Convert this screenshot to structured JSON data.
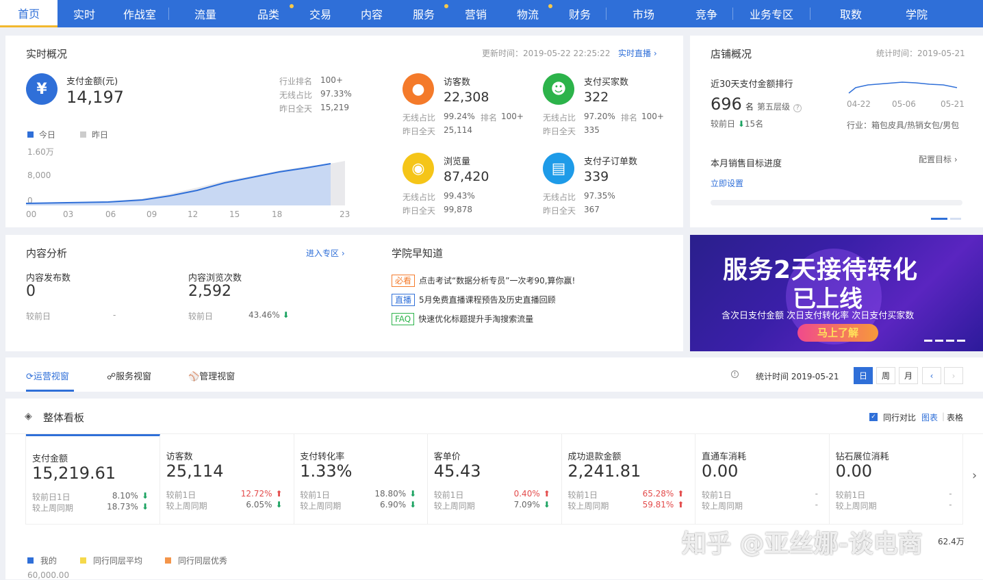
{
  "nav": {
    "items": [
      {
        "label": "首页",
        "x": "active"
      },
      {
        "label": "实时"
      },
      {
        "label": "作战室"
      },
      {
        "label": "流量"
      },
      {
        "label": "品类",
        "dot": true
      },
      {
        "label": "交易"
      },
      {
        "label": "内容"
      },
      {
        "label": "服务",
        "dot": true
      },
      {
        "label": "营销"
      },
      {
        "label": "物流",
        "dot": true
      },
      {
        "label": "财务"
      },
      {
        "label": "市场"
      },
      {
        "label": "竞争"
      },
      {
        "label": "业务专区"
      },
      {
        "label": "取数"
      },
      {
        "label": "学院"
      }
    ]
  },
  "realtime": {
    "title": "实时概况",
    "update_label": "更新时间：2019-05-22 22:25:22",
    "live_link": "实时直播",
    "pay": {
      "label": "支付金额(元)",
      "value": "14,197",
      "rank_label": "行业排名",
      "rank": "100+",
      "wireless_label": "无线占比",
      "wireless": "97.33%",
      "yday_label": "昨日全天",
      "yday": "15,219"
    },
    "legend_today": "今日",
    "legend_yesterday": "昨日",
    "y_ticks": [
      "1.60万",
      "8,000",
      "0"
    ],
    "x_ticks": [
      "00",
      "03",
      "06",
      "09",
      "12",
      "15",
      "18",
      "23"
    ],
    "metrics": [
      {
        "label": "访客数",
        "value": "22,308",
        "wireless_label": "无线占比",
        "wireless": "99.24%",
        "rank_label": "排名",
        "rank": "100+",
        "yday_label": "昨日全天",
        "yday": "25,114",
        "color": "#f47a2a",
        "icon": "footprint-icon"
      },
      {
        "label": "支付买家数",
        "value": "322",
        "wireless_label": "无线占比",
        "wireless": "97.20%",
        "rank_label": "排名",
        "rank": "100+",
        "yday_label": "昨日全天",
        "yday": "335",
        "color": "#2cb34a",
        "icon": "users-icon"
      },
      {
        "label": "浏览量",
        "value": "87,420",
        "wireless_label": "无线占比",
        "wireless": "99.43%",
        "rank_label": "",
        "rank": "",
        "yday_label": "昨日全天",
        "yday": "99,878",
        "color": "#f5c518",
        "icon": "eye-icon"
      },
      {
        "label": "支付子订单数",
        "value": "339",
        "wireless_label": "无线占比",
        "wireless": "97.35%",
        "rank_label": "",
        "rank": "",
        "yday_label": "昨日全天",
        "yday": "367",
        "color": "#1e9be8",
        "icon": "document-icon"
      }
    ]
  },
  "shop": {
    "title": "店铺概况",
    "stat_time": "统计时间：2019-05-21",
    "rank_title": "近30天支付金额排行",
    "rank_value": "696",
    "rank_unit": "名",
    "tier": "第五层级",
    "compare_label": "较前日",
    "compare_value": "15名",
    "spark_dates": [
      "04-22",
      "05-06",
      "05-21"
    ],
    "industry": "行业：箱包皮具/热销女包/男包",
    "target_title": "本月销售目标进度",
    "target_config": "配置目标",
    "target_link": "立即设置"
  },
  "content": {
    "title": "内容分析",
    "enter": "进入专区",
    "publish_label": "内容发布数",
    "publish_value": "0",
    "publish_compare_label": "较前日",
    "publish_compare": "-",
    "views_label": "内容浏览次数",
    "views_value": "2,592",
    "views_compare_label": "较前日",
    "views_compare": "43.46%"
  },
  "academy": {
    "title": "学院早知道",
    "items": [
      {
        "tag": "必看",
        "text": "点击考试“数据分析专员”一次考90,算你赢!",
        "color": "#f47a2a"
      },
      {
        "tag": "直播",
        "text": "5月免费直播课程预告及历史直播回顾",
        "color": "#2f6fd8"
      },
      {
        "tag": "FAQ",
        "text": "快速优化标题提升手淘搜索流量",
        "color": "#2cb34a"
      }
    ]
  },
  "banner": {
    "line1": "服务2天接待转化",
    "line2": "已上线",
    "sub": "含次日支付金额   次日支付转化率   次日支付买家数",
    "cta": "马上了解"
  },
  "tabs": {
    "items": [
      "运营视窗",
      "服务视窗",
      "管理视窗"
    ],
    "stat_time": "统计时间 2019-05-21",
    "period": [
      "日",
      "周",
      "月"
    ]
  },
  "board": {
    "title": "整体看板",
    "peer_label": "同行对比",
    "view_chart": "图表",
    "view_table": "表格",
    "kpis": [
      {
        "label": "支付金额",
        "value": "15,219.61",
        "c1": "较前日1日",
        "p1": "8.10%",
        "d1": "down",
        "c2": "较上周同期",
        "p2": "18.73%",
        "d2": "down"
      },
      {
        "label": "访客数",
        "value": "25,114",
        "c1": "较前1日",
        "p1": "12.72%",
        "d1": "up",
        "c2": "较上周同期",
        "p2": "6.05%",
        "d2": "down"
      },
      {
        "label": "支付转化率",
        "value": "1.33%",
        "c1": "较前1日",
        "p1": "18.80%",
        "d1": "down",
        "c2": "较上周同期",
        "p2": "6.90%",
        "d2": "down"
      },
      {
        "label": "客单价",
        "value": "45.43",
        "c1": "较前1日",
        "p1": "0.40%",
        "d1": "up",
        "c2": "较上周同期",
        "p2": "7.09%",
        "d2": "down"
      },
      {
        "label": "成功退款金额",
        "value": "2,241.81",
        "c1": "较前1日",
        "p1": "65.28%",
        "d1": "up",
        "c2": "较上周同期",
        "p2": "59.81%",
        "d2": "up"
      },
      {
        "label": "直通车消耗",
        "value": "0.00",
        "c1": "较前1日",
        "p1": "-",
        "d1": "",
        "c2": "较上周同期",
        "p2": "-",
        "d2": ""
      },
      {
        "label": "钻石展位消耗",
        "value": "0.00",
        "c1": "较前1日",
        "p1": "-",
        "d1": "",
        "c2": "较上周同期",
        "p2": "-",
        "d2": ""
      }
    ],
    "legend": [
      {
        "label": "我的",
        "color": "#2f6fd8"
      },
      {
        "label": "同行同层平均",
        "color": "#f5d94b"
      },
      {
        "label": "同行同层优秀",
        "color": "#f4954a"
      }
    ],
    "y_first": "60,000.00",
    "right_value": "62.4万"
  },
  "watermark": "知乎 @亚丝娜-谈电商"
}
